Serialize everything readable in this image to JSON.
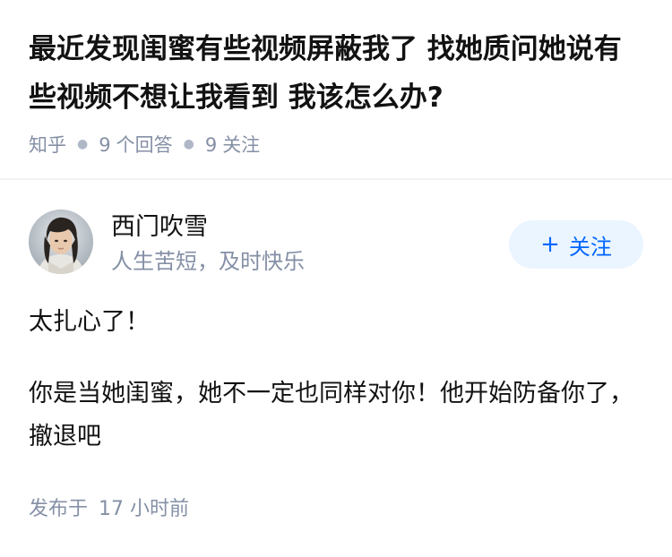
{
  "question": {
    "title": "最近发现闺蜜有些视频屏蔽我了 找她质问她说有些视频不想让我看到 我该怎么办?",
    "source": "知乎",
    "answers_count": "9",
    "answers_label": "个回答",
    "followers_count": "9",
    "followers_label": "关注"
  },
  "author": {
    "name": "西门吹雪",
    "bio": "人生苦短，及时快乐",
    "avatar_icon": "user-avatar"
  },
  "follow_button": {
    "plus": "+",
    "label": "关注",
    "color": "#0066ff",
    "background": "#ebf5ff"
  },
  "answer": {
    "paragraphs": [
      "太扎心了！",
      "你是当她闺蜜，她不一定也同样对你！他开始防备你了，撤退吧"
    ]
  },
  "published": {
    "label": "发布于",
    "time": "17 小时前"
  }
}
